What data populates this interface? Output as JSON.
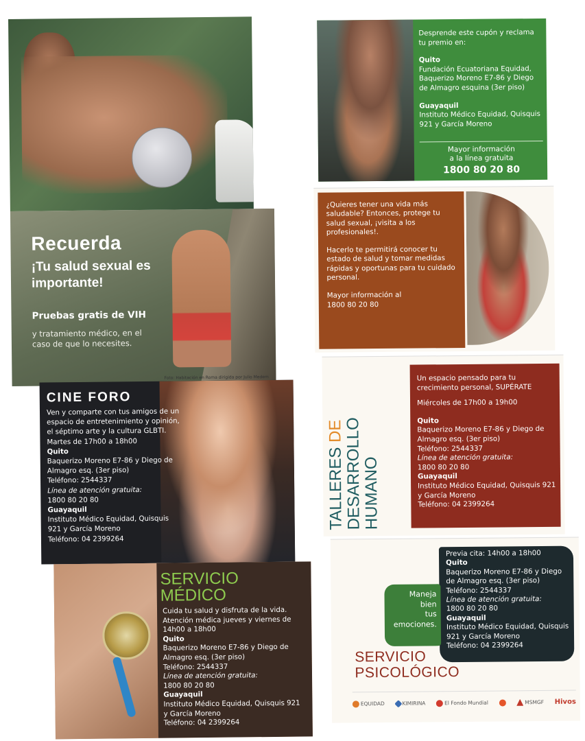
{
  "cover": {
    "sticker_label": ""
  },
  "recuerda": {
    "title": "Recuerda",
    "subtitle": "¡Tu salud sexual es importante!",
    "tests": "Pruebas gratis de VIH",
    "more": "y tratamiento médico, en el caso de que lo necesites.",
    "photo_credit": "Foto: Habitación en Roma dirigida por Julio Medem"
  },
  "cine": {
    "title": "CINE FORO",
    "intro": "Ven y comparte con tus amigos de un espacio de entretenimiento y opinión, el séptimo arte y la cultura GLBTI. Martes de 17h00 a 18h00",
    "quito_label": "Quito",
    "quito_address": "Baquerizo Moreno E7-86 y Diego de Almagro esq. (3er piso)",
    "quito_phone": "Teléfono: 2544337",
    "free_line_label": "Línea de atención gratuita:",
    "free_line": "1800 80 20 80",
    "gye_label": "Guayaquil",
    "gye_address": "Instituto Médico Equidad, Quisquis 921 y García Moreno",
    "gye_phone": "Teléfono: 04 2399264"
  },
  "medico": {
    "title_line1": "SERVICIO",
    "title_line2": "MÉDICO",
    "intro": "Cuida tu salud y disfruta de la vida. Atención médica jueves y viernes de 14h00 a 18h00",
    "quito_label": "Quito",
    "quito_address": "Baquerizo Moreno E7-86 y Diego de Almagro esq. (3er piso)",
    "quito_phone": "Teléfono: 2544337",
    "free_line_label": "Línea de atención gratuita:",
    "free_line": "1800 80 20 80",
    "gye_label": "Guayaquil",
    "gye_address": "Instituto Médico Equidad, Quisquis 921 y García Moreno",
    "gye_phone": "Teléfono: 04 2399264"
  },
  "coupon": {
    "intro": "Desprende este cupón y reclama tu premio en:",
    "quito_label": "Quito",
    "quito_address": "Fundación Ecuatoriana Equidad, Baquerizo Moreno E7-86 y Diego de Almagro esquina (3er piso)",
    "gye_label": "Guayaquil",
    "gye_address": "Instituto Médico Equidad, Quisquis 921 y García Moreno",
    "more_line1": "Mayor información",
    "more_line2": "a la línea gratuita",
    "phone": "1800 80 20 80"
  },
  "salud": {
    "p1": "¿Quieres tener una vida más saludable? Entonces, protege tu salud sexual, ¡visita a los profesionales!.",
    "p2": "Hacerlo te permitirá conocer tu estado de salud y tomar medidas rápidas y oportunas para tu cuidado personal.",
    "p3_label": "Mayor información al",
    "p3_phone": "1800 80 20 80"
  },
  "talleres": {
    "title_word1": "TALLERES",
    "title_word2": "DE",
    "title_line2": "DESARROLLO",
    "title_line3": "HUMANO",
    "intro": "Un espacio pensado para tu crecimiento personal, SUPÉRATE",
    "schedule": "Miércoles de 17h00 a 19h00",
    "quito_label": "Quito",
    "quito_address": "Baquerizo Moreno E7-86 y Diego de Almagro esq. (3er piso)",
    "quito_phone": "Teléfono: 2544337",
    "free_line_label": "Línea de atención gratuita:",
    "free_line": "1800 80 20 80",
    "gye_label": "Guayaquil",
    "gye_address": "Instituto Médico Equidad, Quisquis 921 y García Moreno",
    "gye_phone": "Teléfono: 04 2399264"
  },
  "psico": {
    "schedule": "Previa cita: 14h00 a 18h00",
    "quito_label": "Quito",
    "quito_address": "Baquerizo Moreno E7-86 y Diego de Almagro esq. (3er piso)",
    "quito_phone": "Teléfono: 2544337",
    "free_line_label": "Línea de atención gratuita:",
    "free_line": "1800 80 20 80",
    "gye_label": "Guayaquil",
    "gye_address": "Instituto Médico Equidad, Quisquis 921 y García Moreno",
    "gye_phone": "Teléfono: 04 2399264",
    "bubble_l1": "Maneja",
    "bubble_l2": "bien",
    "bubble_l3": "tus",
    "bubble_l4": "emociones.",
    "title_line1": "SERVICIO",
    "title_line2": "PSICOLÓGICO"
  },
  "logos": {
    "equidad": "EQUIDAD",
    "kimirina": "KIMIRINA",
    "fondo": "El Fondo Mundial",
    "msm": "MSMGF",
    "hivos": "Hivos"
  },
  "colors": {
    "coupon_green": "#3f8d3d",
    "salud_brown": "#9a4a1e",
    "talleres_red": "#8e2c1f",
    "psico_dark": "#1e2a2e",
    "medico_green": "#8ecb4f"
  }
}
